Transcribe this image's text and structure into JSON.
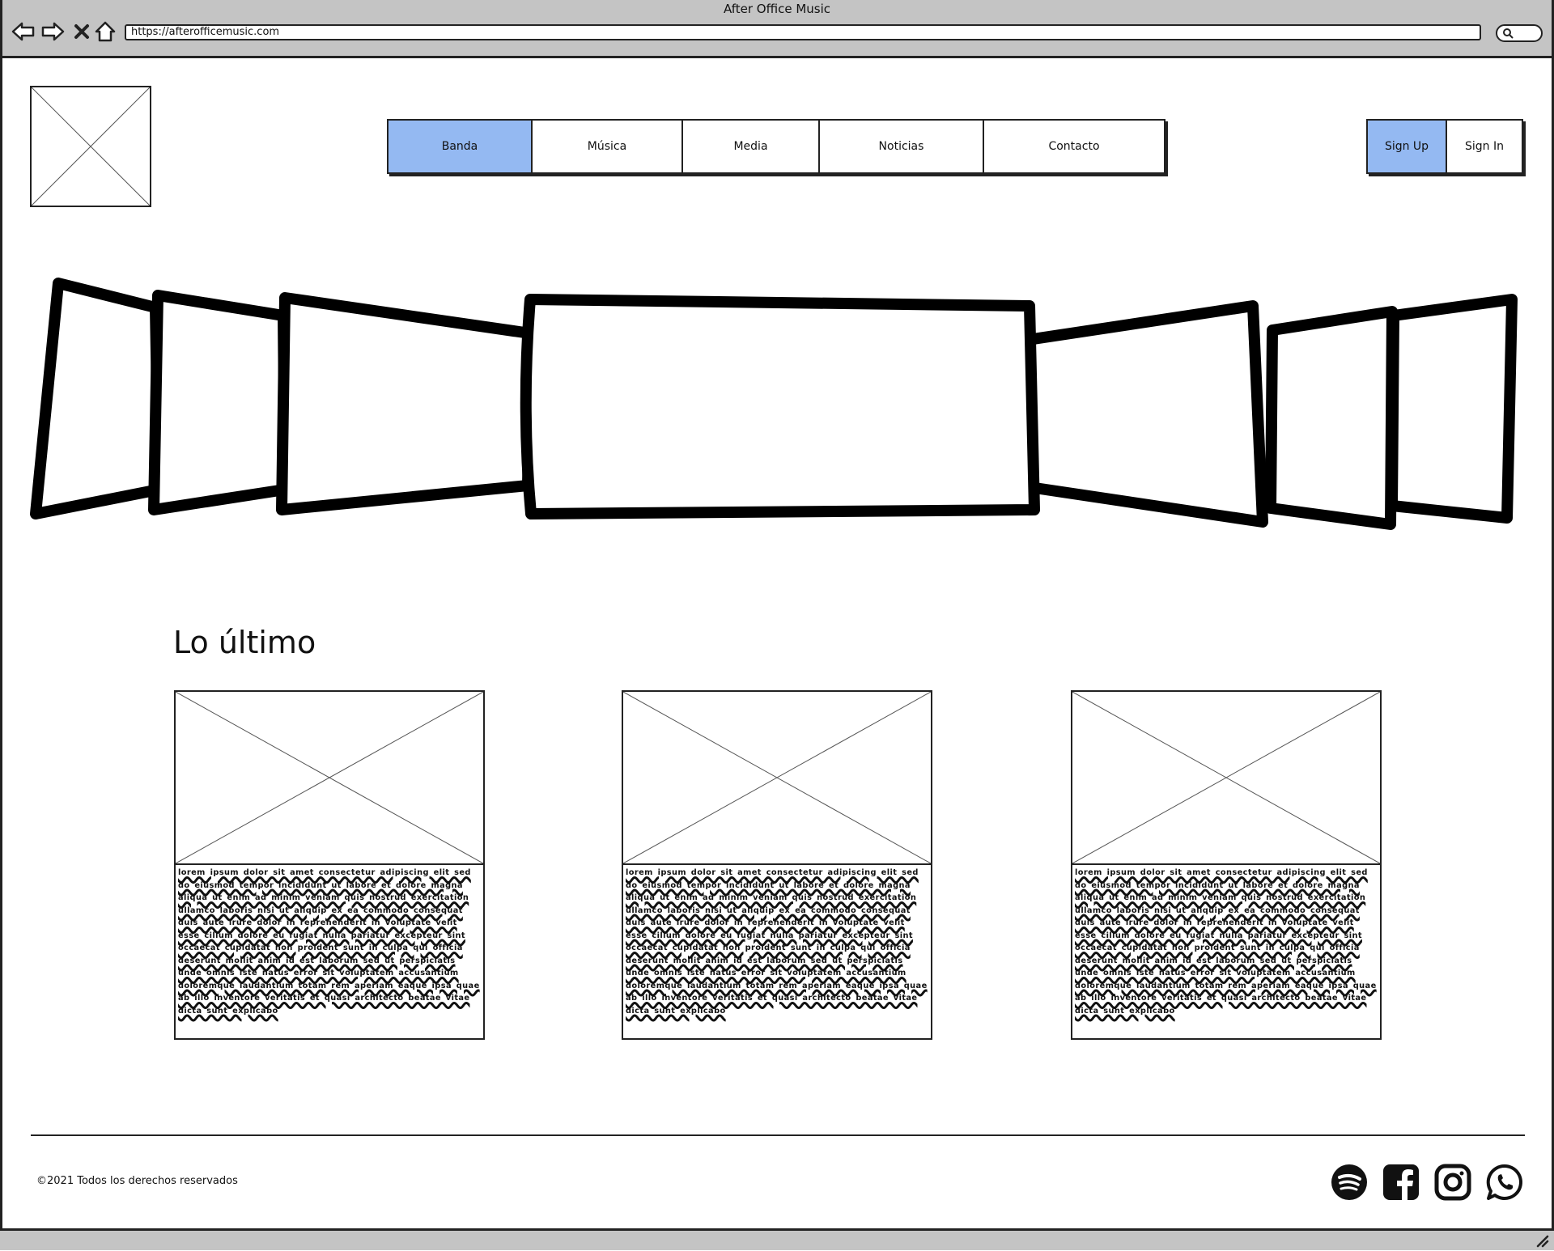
{
  "window": {
    "title": "After Office Music"
  },
  "address_bar": {
    "url": "https://afterofficemusic.com"
  },
  "nav": {
    "items": [
      {
        "label": "Banda",
        "active": true
      },
      {
        "label": "Música"
      },
      {
        "label": "Media"
      },
      {
        "label": "Noticias"
      },
      {
        "label": "Contacto"
      }
    ]
  },
  "auth": {
    "sign_up": "Sign Up",
    "sign_in": "Sign In"
  },
  "latest": {
    "heading": "Lo último",
    "cards": [
      {
        "text": "lorem ipsum dolor sit amet consectetur adipiscing elit sed do eiusmod tempor incididunt ut labore et dolore magna aliqua ut enim ad minim veniam quis nostrud exercitation ullamco laboris nisi ut aliquip ex ea commodo consequat duis aute irure dolor in reprehenderit in voluptate velit esse cillum dolore eu fugiat nulla pariatur excepteur sint occaecat cupidatat non proident sunt in culpa qui officia deserunt mollit anim id est laborum sed ut perspiciatis unde omnis iste natus error sit voluptatem accusantium doloremque laudantium totam rem aperiam eaque ipsa quae ab illo inventore veritatis et quasi architecto beatae vitae dicta sunt explicabo"
      },
      {
        "text": "lorem ipsum dolor sit amet consectetur adipiscing elit sed do eiusmod tempor incididunt ut labore et dolore magna aliqua ut enim ad minim veniam quis nostrud exercitation ullamco laboris nisi ut aliquip ex ea commodo consequat duis aute irure dolor in reprehenderit in voluptate velit esse cillum dolore eu fugiat nulla pariatur excepteur sint occaecat cupidatat non proident sunt in culpa qui officia deserunt mollit anim id est laborum sed ut perspiciatis unde omnis iste natus error sit voluptatem accusantium doloremque laudantium totam rem aperiam eaque ipsa quae ab illo inventore veritatis et quasi architecto beatae vitae dicta sunt explicabo"
      },
      {
        "text": "lorem ipsum dolor sit amet consectetur adipiscing elit sed do eiusmod tempor incididunt ut labore et dolore magna aliqua ut enim ad minim veniam quis nostrud exercitation ullamco laboris nisi ut aliquip ex ea commodo consequat duis aute irure dolor in reprehenderit in voluptate velit esse cillum dolore eu fugiat nulla pariatur excepteur sint occaecat cupidatat non proident sunt in culpa qui officia deserunt mollit anim id est laborum sed ut perspiciatis unde omnis iste natus error sit voluptatem accusantium doloremque laudantium totam rem aperiam eaque ipsa quae ab illo inventore veritatis et quasi architecto beatae vitae dicta sunt explicabo"
      }
    ]
  },
  "footer": {
    "copyright": "©2021 Todos los derechos reservados",
    "social_icons": [
      "spotify-icon",
      "facebook-icon",
      "instagram-icon",
      "whatsapp-icon"
    ]
  },
  "colors": {
    "active_nav": "#94b9f2",
    "chrome": "#c4c4c4",
    "stroke": "#222222"
  }
}
